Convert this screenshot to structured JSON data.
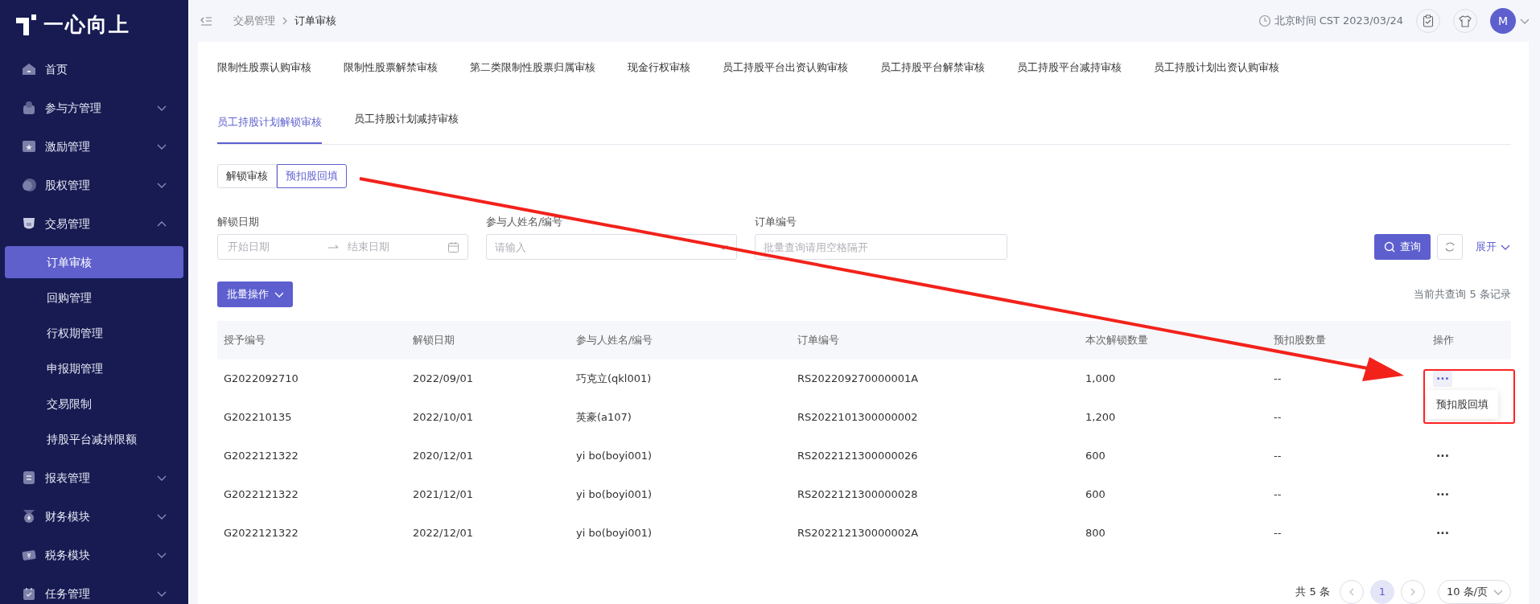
{
  "logo": {
    "text": "一心向上"
  },
  "sidebar": {
    "items": [
      {
        "label": "首页",
        "kind": "link",
        "selected": false
      },
      {
        "label": "参与方管理",
        "kind": "group",
        "expanded": false
      },
      {
        "label": "激励管理",
        "kind": "group",
        "expanded": false
      },
      {
        "label": "股权管理",
        "kind": "group",
        "expanded": false
      },
      {
        "label": "交易管理",
        "kind": "group",
        "expanded": true,
        "children": [
          {
            "label": "订单审核",
            "selected": true
          },
          {
            "label": "回购管理",
            "selected": false
          },
          {
            "label": "行权期管理",
            "selected": false
          },
          {
            "label": "申报期管理",
            "selected": false
          },
          {
            "label": "交易限制",
            "selected": false
          },
          {
            "label": "持股平台减持限额",
            "selected": false
          }
        ]
      },
      {
        "label": "报表管理",
        "kind": "group",
        "expanded": false
      },
      {
        "label": "财务模块",
        "kind": "group",
        "expanded": false
      },
      {
        "label": "税务模块",
        "kind": "group",
        "expanded": false
      },
      {
        "label": "任务管理",
        "kind": "group",
        "expanded": false
      }
    ]
  },
  "breadcrumb": [
    "交易管理",
    "订单审核"
  ],
  "header": {
    "time": "北京时间 CST 2023/03/24",
    "avatar": "M"
  },
  "tabs": [
    {
      "label": "限制性股票认购审核",
      "selected": false
    },
    {
      "label": "限制性股票解禁审核",
      "selected": false
    },
    {
      "label": "第二类限制性股票归属审核",
      "selected": false
    },
    {
      "label": "现金行权审核",
      "selected": false
    },
    {
      "label": "员工持股平台出资认购审核",
      "selected": false
    },
    {
      "label": "员工持股平台解禁审核",
      "selected": false
    },
    {
      "label": "员工持股平台减持审核",
      "selected": false
    },
    {
      "label": "员工持股计划出资认购审核",
      "selected": false
    },
    {
      "label": "员工持股计划解锁审核",
      "selected": true
    },
    {
      "label": "员工持股计划减持审核",
      "selected": false
    }
  ],
  "sub_tabs": [
    {
      "label": "解锁审核",
      "selected": false
    },
    {
      "label": "预扣股回填",
      "selected": true
    }
  ],
  "filters": [
    {
      "label": "解锁日期",
      "kind": "daterange",
      "start_placeholder": "开始日期",
      "end_placeholder": "结束日期"
    },
    {
      "label": "参与人姓名/编号",
      "kind": "select",
      "placeholder": "请输入"
    },
    {
      "label": "订单编号",
      "kind": "text",
      "placeholder": "批量查询请用空格隔开"
    }
  ],
  "search_button": "查询",
  "expand_link": "展开",
  "batch_button": "批量操作",
  "record_count": "当前共查询 5 条记录",
  "table": {
    "columns": [
      "授予编号",
      "解锁日期",
      "参与人姓名/编号",
      "订单编号",
      "本次解锁数量",
      "预扣股数量",
      "操作"
    ],
    "rows": [
      {
        "cells": [
          "G2022092710",
          "2022/09/01",
          "巧克立(qkl001)",
          "RS202209270000001A",
          "1,000",
          "--"
        ],
        "action": "···",
        "menu_open": true
      },
      {
        "cells": [
          "G202210135",
          "2022/10/01",
          "英豪(a107)",
          "RS2022101300000002",
          "1,200",
          "--"
        ]
      },
      {
        "cells": [
          "G2022121322",
          "2020/12/01",
          "yi bo(boyi001)",
          "RS2022121300000026",
          "600",
          "--"
        ],
        "action": "···",
        "menu_open": false
      },
      {
        "cells": [
          "G2022121322",
          "2021/12/01",
          "yi bo(boyi001)",
          "RS2022121300000028",
          "600",
          "--"
        ],
        "action": "···",
        "menu_open": false
      },
      {
        "cells": [
          "G2022121322",
          "2022/12/01",
          "yi bo(boyi001)",
          "RS202212130000002A",
          "800",
          "--"
        ],
        "action": "···",
        "menu_open": false
      }
    ],
    "row_menu": [
      "预扣股回填"
    ]
  },
  "pagination": {
    "total": "共 5 条",
    "pages": [
      {
        "label": "1",
        "selected": true
      }
    ],
    "page_size": "10 条/页"
  }
}
